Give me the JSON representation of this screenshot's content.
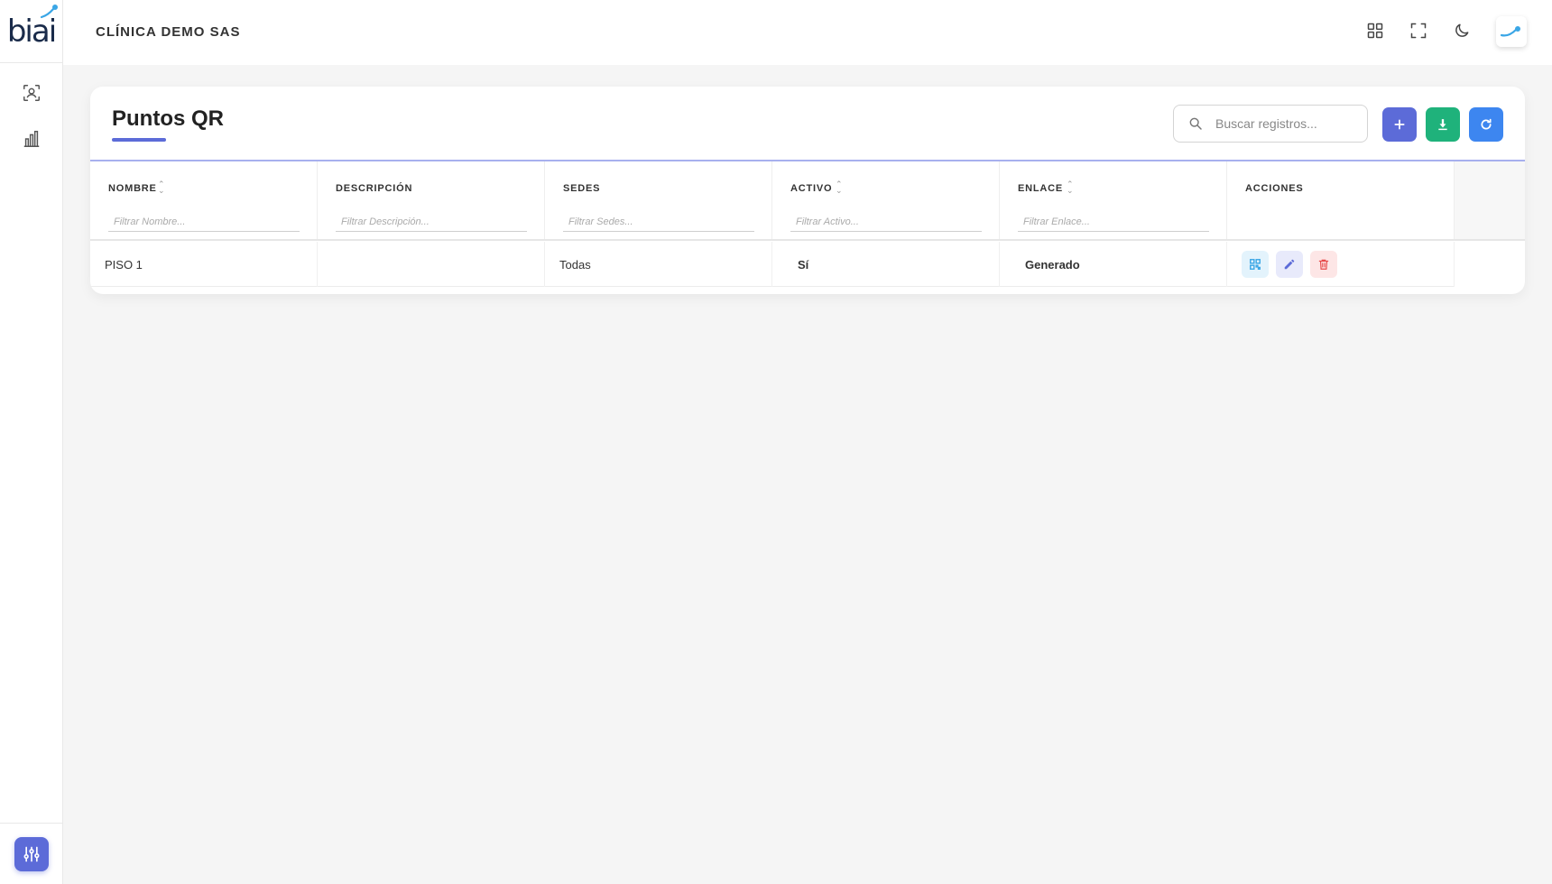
{
  "brand": {
    "logo_text": "biai"
  },
  "header": {
    "company": "CLÍNICA DEMO SAS"
  },
  "sidebar": {
    "items": [
      {
        "icon": "face-scan-icon"
      },
      {
        "icon": "bar-chart-icon"
      }
    ],
    "bottom_icon": "sliders-icon"
  },
  "page": {
    "title": "Puntos QR",
    "search_placeholder": "Buscar registros..."
  },
  "table": {
    "columns": [
      {
        "label": "NOMBRE",
        "sortable": true,
        "filter_placeholder": "Filtrar Nombre..."
      },
      {
        "label": "DESCRIPCIÓN",
        "sortable": false,
        "filter_placeholder": "Filtrar Descripción..."
      },
      {
        "label": "SEDES",
        "sortable": false,
        "filter_placeholder": "Filtrar Sedes..."
      },
      {
        "label": "ACTIVO",
        "sortable": true,
        "filter_placeholder": "Filtrar Activo..."
      },
      {
        "label": "ENLACE",
        "sortable": true,
        "filter_placeholder": "Filtrar Enlace..."
      },
      {
        "label": "ACCIONES",
        "sortable": false
      }
    ],
    "rows": [
      {
        "nombre": "PISO 1",
        "descripcion": "",
        "sedes": "Todas",
        "activo": "Sí",
        "enlace": "Generado"
      }
    ]
  },
  "colors": {
    "primary": "#5c6bd8",
    "success": "#1fb27b",
    "info": "#3d86f0",
    "danger": "#e74a4a",
    "qr_blue": "#3aa6e6"
  }
}
